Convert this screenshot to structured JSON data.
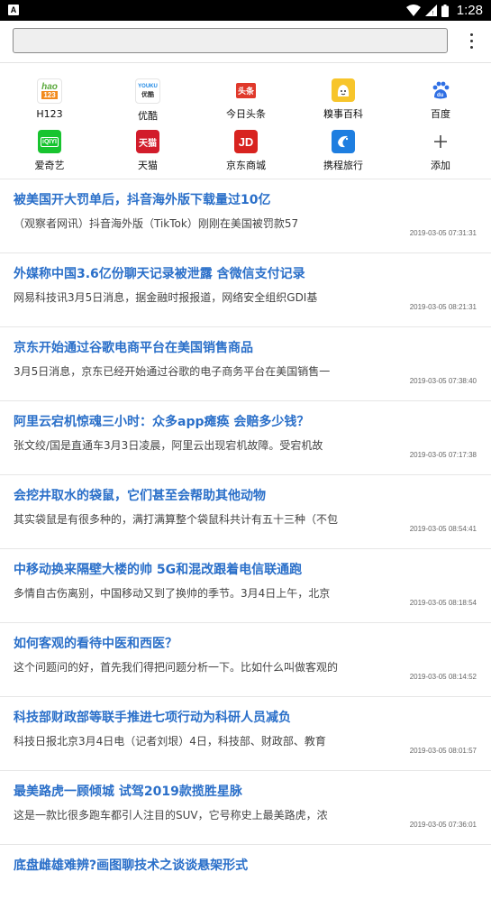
{
  "status_bar": {
    "app_icon_letter": "A",
    "time": "1:28"
  },
  "search": {
    "value": "",
    "placeholder": ""
  },
  "shortcuts": [
    {
      "label": "H123",
      "icon": "hao123-icon"
    },
    {
      "label": "优酷",
      "icon": "youku-icon"
    },
    {
      "label": "今日头条",
      "icon": "toutiao-icon"
    },
    {
      "label": "糗事百科",
      "icon": "qiushibaike-icon"
    },
    {
      "label": "百度",
      "icon": "baidu-icon"
    },
    {
      "label": "爱奇艺",
      "icon": "iqiyi-icon"
    },
    {
      "label": "天猫",
      "icon": "tmall-icon"
    },
    {
      "label": "京东商城",
      "icon": "jd-icon"
    },
    {
      "label": "携程旅行",
      "icon": "ctrip-icon"
    },
    {
      "label": "添加",
      "icon": "plus-icon"
    }
  ],
  "icon_text": {
    "hao123": "hao",
    "hao123_num": "123",
    "youku": "YOUKU",
    "youku_cn": "优酷",
    "toutiao": "头条",
    "iqiyi": "iQIYI",
    "tmall": "天猫",
    "jd": "JD",
    "baidu": "du"
  },
  "news": [
    {
      "title": "被美国开大罚单后，抖音海外版下载量过10亿",
      "summary": "（观察者网讯）抖音海外版（TikTok）刚刚在美国被罚款57",
      "date": "2019-03-05 07:31:31"
    },
    {
      "title": "外媒称中国3.6亿份聊天记录被泄露 含微信支付记录",
      "summary": "网易科技讯3月5日消息，据金融时报报道，网络安全组织GDI基",
      "date": "2019-03-05 08:21:31"
    },
    {
      "title": "京东开始通过谷歌电商平台在美国销售商品",
      "summary": "3月5日消息，京东已经开始通过谷歌的电子商务平台在美国销售一",
      "date": "2019-03-05 07:38:40"
    },
    {
      "title": "阿里云宕机惊魂三小时：众多app瘫痪 会赔多少钱？",
      "summary": "张文绞/国是直通车3月3日凌晨，阿里云出现宕机故障。受宕机故",
      "date": "2019-03-05 07:17:38"
    },
    {
      "title": "会挖井取水的袋鼠，它们甚至会帮助其他动物",
      "summary": "其实袋鼠是有很多种的，满打满算整个袋鼠科共计有五十三种（不包",
      "date": "2019-03-05 08:54:41"
    },
    {
      "title": "中移动换来隔壁大楼的帅 5G和混改跟着电信联通跑",
      "summary": "多情自古伤离别，中国移动又到了换帅的季节。3月4日上午，北京",
      "date": "2019-03-05 08:18:54"
    },
    {
      "title": "如何客观的看待中医和西医？",
      "summary": "这个问题问的好，首先我们得把问题分析一下。比如什么叫做客观的",
      "date": "2019-03-05 08:14:52"
    },
    {
      "title": "科技部财政部等联手推进七项行动为科研人员减负",
      "summary": "科技日报北京3月4日电（记者刘垠）4日，科技部、财政部、教育",
      "date": "2019-03-05 08:01:57"
    },
    {
      "title": "最美路虎一顾倾城 试驾2019款揽胜星脉",
      "summary": "这是一款比很多跑车都引人注目的SUV，它号称史上最美路虎，浓",
      "date": "2019-03-05 07:36:01"
    },
    {
      "title": "底盘雌雄难辨?画图聊技术之谈谈悬架形式",
      "summary": "",
      "date": ""
    }
  ]
}
